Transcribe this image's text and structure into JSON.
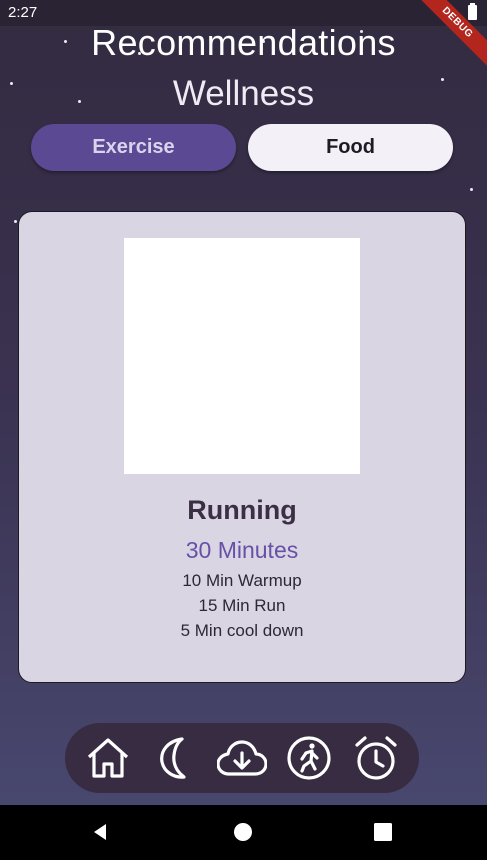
{
  "status_bar": {
    "time": "2:27",
    "debug_label": "DEBUG"
  },
  "header": {
    "title": "Recommendations",
    "subtitle": "Wellness"
  },
  "tabs": [
    {
      "label": "Exercise",
      "selected": true
    },
    {
      "label": "Food",
      "selected": false
    }
  ],
  "card": {
    "name": "Running",
    "duration": "30 Minutes",
    "steps": [
      "10 Min Warmup",
      "15 Min Run",
      "5 Min cool down"
    ]
  },
  "bottom_nav": {
    "icons": [
      "home-icon",
      "moon-icon",
      "cloud-download-icon",
      "exercise-icon",
      "alarm-icon"
    ]
  },
  "system_nav": {
    "icons": [
      "back-icon",
      "home-circle-icon",
      "recents-icon"
    ]
  },
  "colors": {
    "accent": "#5b4a93",
    "duration_text": "#6751a8",
    "card_bg": "#dad5e2",
    "nav_bg": "#372c42"
  }
}
